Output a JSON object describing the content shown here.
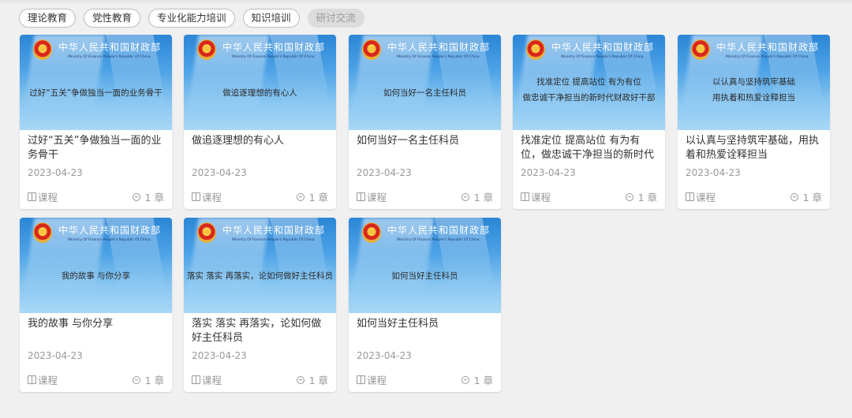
{
  "tabs": [
    {
      "label": "理论教育",
      "active": false
    },
    {
      "label": "党性教育",
      "active": false
    },
    {
      "label": "专业化能力培训",
      "active": false
    },
    {
      "label": "知识培训",
      "active": false
    },
    {
      "label": "研讨交流",
      "active": true
    }
  ],
  "thumb_brand": {
    "ministry_cn": "中华人民共和国财政部",
    "ministry_en": "Ministry Of Finance People's Republic Of China"
  },
  "courses": [
    {
      "banner": [
        "过好“五关”争做独当一面的业务骨干"
      ],
      "title": "过好“五关”争做独当一面的业务骨干",
      "date": "2023-04-23",
      "type": "课程",
      "chapters": "1 章"
    },
    {
      "banner": [
        "做追逐理想的有心人"
      ],
      "title": "做追逐理想的有心人",
      "date": "2023-04-23",
      "type": "课程",
      "chapters": "1 章"
    },
    {
      "banner": [
        "如何当好一名主任科员"
      ],
      "title": "如何当好一名主任科员",
      "date": "2023-04-23",
      "type": "课程",
      "chapters": "1 章"
    },
    {
      "banner": [
        "找准定位 提高站位 有为有位",
        "做忠诚干净担当的新时代财政好干部"
      ],
      "title": "找准定位 提高站位 有为有位，做忠诚干净担当的新时代",
      "date": "2023-04-23",
      "type": "课程",
      "chapters": "1 章"
    },
    {
      "banner": [
        "以认真与坚持筑牢基础",
        "用执着和热爱诠释担当"
      ],
      "title": "以认真与坚持筑牢基础，用执着和热爱诠释担当",
      "date": "2023-04-23",
      "type": "课程",
      "chapters": "1 章"
    },
    {
      "banner": [
        "我的故事 与你分享"
      ],
      "title": "我的故事 与你分享",
      "date": "2023-04-23",
      "type": "课程",
      "chapters": "1 章"
    },
    {
      "banner": [
        "落实 落实 再落实，论如何做好主任科员"
      ],
      "title": "落实 落实 再落实，论如何做好主任科员",
      "date": "2023-04-23",
      "type": "课程",
      "chapters": "1 章"
    },
    {
      "banner": [
        "如何当好主任科员"
      ],
      "title": "如何当好主任科员",
      "date": "2023-04-23",
      "type": "课程",
      "chapters": "1 章"
    }
  ]
}
